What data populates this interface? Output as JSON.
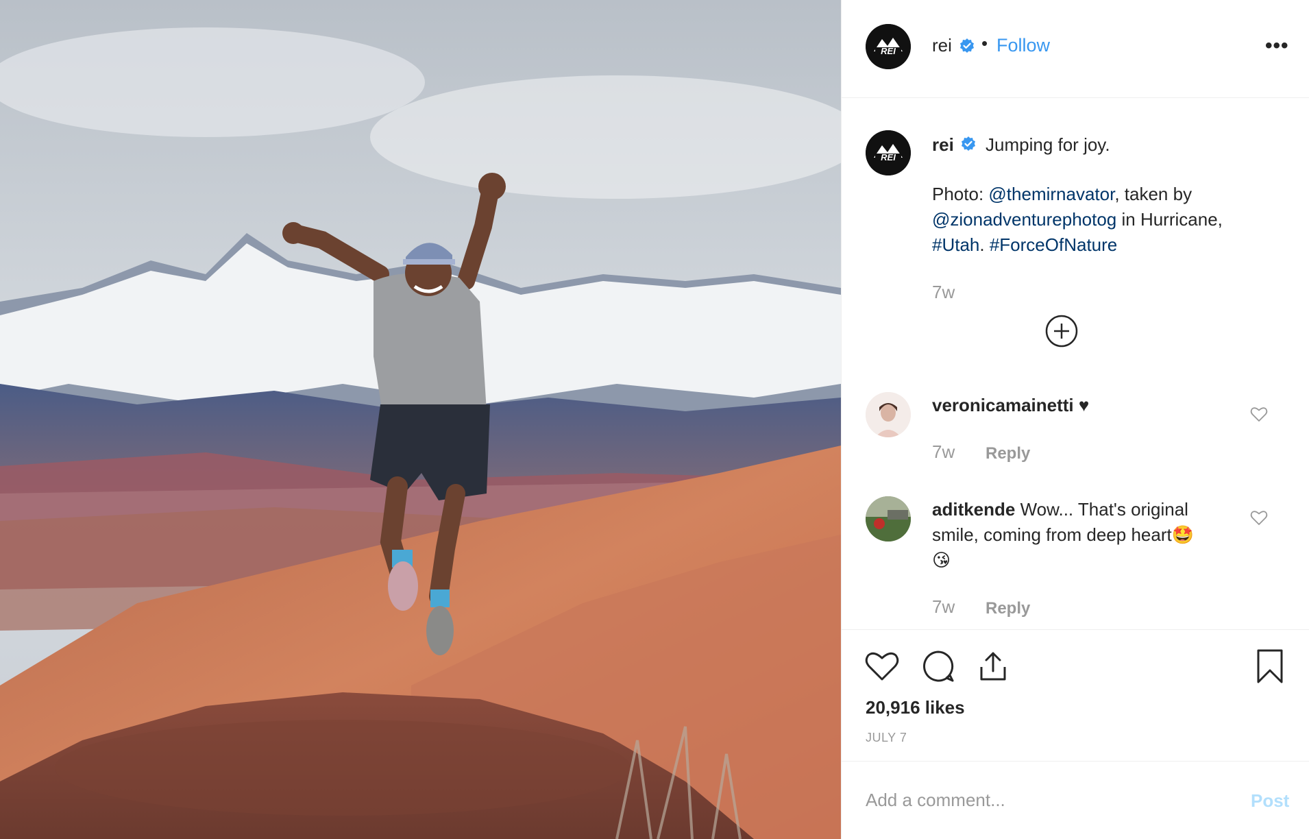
{
  "header": {
    "username": "rei",
    "separator": "•",
    "follow_label": "Follow",
    "more_label": "•••"
  },
  "caption": {
    "username": "rei",
    "text": "Jumping for joy.",
    "line1_prefix": "Photo: ",
    "line1_mention": "@themirnavator",
    "line1_suffix": ", taken by",
    "line2_mention": "@zionadventurephotog",
    "line2_suffix": " in Hurricane,",
    "line3_hashtag1": "#Utah",
    "line3_sep": ". ",
    "line3_hashtag2": "#ForceOfNature",
    "time": "7w"
  },
  "comments": [
    {
      "username": "veronicamainetti",
      "text": " ♥",
      "time": "7w",
      "reply_label": "Reply"
    },
    {
      "username": "aditkende",
      "text_line1": " Wow... That's original",
      "text_line2": "smile, coming from deep heart🤩",
      "text_line3": "😘",
      "time": "7w",
      "reply_label": "Reply"
    }
  ],
  "likes_text": "20,916 likes",
  "date_text": "JULY 7",
  "comment_box": {
    "placeholder": "Add a comment...",
    "post_label": "Post"
  },
  "colors": {
    "link": "#003569",
    "follow": "#3897f0",
    "verified": "#3897f0",
    "muted": "#999999"
  },
  "icons": [
    "rei-logo",
    "verified-badge-icon",
    "more-icon",
    "add-icon",
    "heart-icon",
    "comment-icon",
    "share-icon",
    "bookmark-icon"
  ]
}
